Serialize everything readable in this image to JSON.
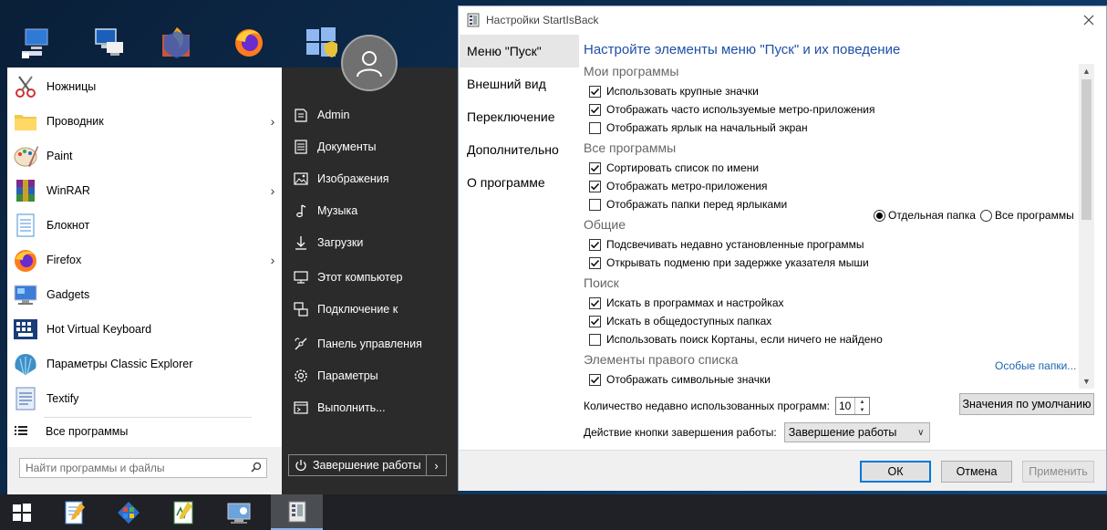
{
  "desktop": {
    "icons": [
      "network-computer-icon",
      "remote-desktop-icon",
      "firewall-icon",
      "firefox-icon",
      "windows-shield-icon"
    ]
  },
  "start_menu": {
    "apps": [
      {
        "label": "Ножницы",
        "icon": "scissors-icon",
        "has_submenu": false
      },
      {
        "label": "Проводник",
        "icon": "folder-icon",
        "has_submenu": true
      },
      {
        "label": "Paint",
        "icon": "paint-icon",
        "has_submenu": false
      },
      {
        "label": "WinRAR",
        "icon": "winrar-icon",
        "has_submenu": true
      },
      {
        "label": "Блокнот",
        "icon": "notepad-icon",
        "has_submenu": false
      },
      {
        "label": "Firefox",
        "icon": "firefox-icon",
        "has_submenu": true
      },
      {
        "label": "Gadgets",
        "icon": "gadgets-icon",
        "has_submenu": false
      },
      {
        "label": "Hot Virtual Keyboard",
        "icon": "keyboard-icon",
        "has_submenu": false
      },
      {
        "label": "Параметры Classic Explorer",
        "icon": "shell-icon",
        "has_submenu": false
      },
      {
        "label": "Textify",
        "icon": "textify-icon",
        "has_submenu": false
      }
    ],
    "all_programs": "Все программы",
    "search_placeholder": "Найти программы и файлы",
    "right_items": [
      {
        "label": "Admin",
        "icon": "user-folder-icon"
      },
      {
        "label": "Документы",
        "icon": "documents-icon"
      },
      {
        "label": "Изображения",
        "icon": "pictures-icon"
      },
      {
        "label": "Музыка",
        "icon": "music-icon"
      },
      {
        "label": "Загрузки",
        "icon": "downloads-icon"
      },
      {
        "label": "Этот компьютер",
        "icon": "computer-icon"
      },
      {
        "label": "Подключение к",
        "icon": "connect-icon"
      },
      {
        "label": "Панель управления",
        "icon": "control-panel-icon"
      },
      {
        "label": "Параметры",
        "icon": "settings-icon"
      },
      {
        "label": "Выполнить...",
        "icon": "run-icon"
      }
    ],
    "shutdown_label": "Завершение работы"
  },
  "taskbar": {
    "buttons": [
      "start-button",
      "notepad-icon",
      "windows-settings-icon",
      "text-editor-icon",
      "control-panel-icon",
      "startisback-icon"
    ]
  },
  "dialog": {
    "title": "Настройки StartIsBack",
    "nav": [
      "Меню \"Пуск\"",
      "Внешний вид",
      "Переключение",
      "Дополнительно",
      "О программе"
    ],
    "selected_nav": 0,
    "heading": "Настройте элементы меню \"Пуск\" и их поведение",
    "sections": [
      {
        "title": "Мои программы",
        "options": [
          {
            "label": "Использовать крупные значки",
            "checked": true
          },
          {
            "label": "Отображать часто используемые метро-приложения",
            "checked": true
          },
          {
            "label": "Отображать ярлык на начальный экран",
            "checked": false
          }
        ]
      },
      {
        "title": "Все программы",
        "options": [
          {
            "label": "Сортировать список по имени",
            "checked": true
          },
          {
            "label": "Отображать метро-приложения",
            "checked": true
          },
          {
            "label": "Отображать папки перед ярлыками",
            "checked": false
          }
        ]
      },
      {
        "title": "Общие",
        "options": [
          {
            "label": "Подсвечивать недавно установленные программы",
            "checked": true
          },
          {
            "label": "Открывать подменю при задержке указателя мыши",
            "checked": true
          }
        ]
      },
      {
        "title": "Поиск",
        "options": [
          {
            "label": "Искать в программах и настройках",
            "checked": true
          },
          {
            "label": "Искать в общедоступных папках",
            "checked": true
          },
          {
            "label": "Использовать поиск Кортаны, если ничего не найдено",
            "checked": false
          }
        ]
      },
      {
        "title": "Элементы правого списка",
        "options": [
          {
            "label": "Отображать символьные значки",
            "checked": true
          }
        ]
      }
    ],
    "radio": [
      {
        "label": "Отдельная папка",
        "selected": true
      },
      {
        "label": "Все программы",
        "selected": false
      }
    ],
    "custom_folders_link": "Особые папки...",
    "recent_count_label": "Количество недавно использованных программ:",
    "recent_count_value": "10",
    "defaults_button": "Значения по умолчанию",
    "shutdown_action_label": "Действие кнопки завершения работы:",
    "shutdown_action_value": "Завершение работы",
    "ok": "ОК",
    "cancel": "Отмена",
    "apply": "Применить"
  }
}
